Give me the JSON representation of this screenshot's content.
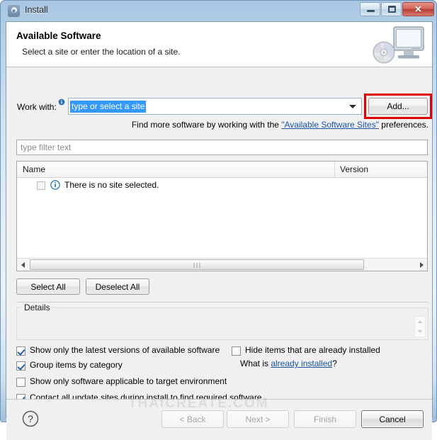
{
  "window": {
    "title": "Install",
    "icon": "gear-icon",
    "controls": {
      "minimize": "minimize-icon",
      "maximize": "maximize-icon",
      "close": "✕"
    }
  },
  "header": {
    "title": "Available Software",
    "subtitle": "Select a site or enter the location of a site.",
    "art": "monitor-with-cd-icon"
  },
  "work_with": {
    "label": "Work with:",
    "info_icon": "info-icon",
    "value": "type or select a site",
    "placeholder": "type or select a site",
    "dropdown_icon": "chevron-down-icon",
    "add_button": "Add...",
    "annotation_color": "#e00000"
  },
  "find_more": {
    "prefix": "Find more software by working with the ",
    "link": "\"Available Software Sites\"",
    "suffix": " preferences."
  },
  "filter": {
    "placeholder": "type filter text",
    "value": ""
  },
  "table": {
    "columns": [
      "Name",
      "Version"
    ],
    "rows": [
      {
        "checked": false,
        "enabled": false,
        "icon": "info-icon",
        "name": "There is no site selected.",
        "version": ""
      }
    ],
    "scrollbar": {
      "left_arrow": "scroll-left-icon",
      "right_arrow": "scroll-right-icon"
    }
  },
  "selection_buttons": {
    "select_all": "Select All",
    "deselect_all": "Deselect All"
  },
  "details": {
    "legend": "Details",
    "content": ""
  },
  "options": [
    {
      "label": "Show only the latest versions of available software",
      "checked": true
    },
    {
      "label": "Group items by category",
      "checked": true
    },
    {
      "label": "Show only software applicable to target environment",
      "checked": false
    },
    {
      "label": "Contact all update sites during install to find required software",
      "checked": true
    }
  ],
  "options_right": [
    {
      "label": "Hide items that are already installed",
      "checked": false
    }
  ],
  "what_is": {
    "prefix": "What is ",
    "link": "already installed",
    "suffix": "?"
  },
  "footer": {
    "help_icon": "help-icon",
    "buttons": [
      {
        "label": "< Back",
        "enabled": false
      },
      {
        "label": "Next >",
        "enabled": false
      },
      {
        "label": "Finish",
        "enabled": false
      },
      {
        "label": "Cancel",
        "enabled": true
      }
    ]
  },
  "watermark": "THAICREATE.COM"
}
